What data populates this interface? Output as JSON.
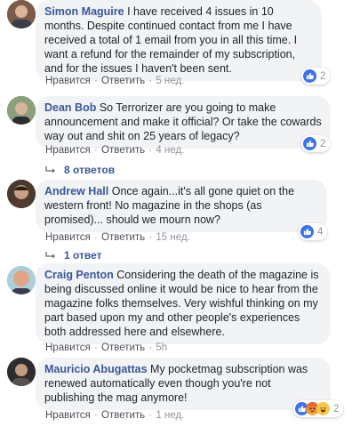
{
  "comments": [
    {
      "author": "Simon Maguire",
      "text": "I have received 4 issues in 10 months. Despite continued contact from me I have received a total of 1 email from you in all this time. I want a refund for the remainder of my subscription, and for the issues I haven't been sent.",
      "like_label": "Нравится",
      "reply_label": "Ответить",
      "time": "5 нед.",
      "reaction_count": "2",
      "avatar_color": "#8a6a57"
    },
    {
      "author": "Dean Bob",
      "text": "So Terrorizer are you going to make announcement and make it official? Or take the cowards way out and shit on 25 years of legacy?",
      "like_label": "Нравится",
      "reply_label": "Ответить",
      "time": "4 нед.",
      "reaction_count": "2",
      "replies_label": "8 ответов",
      "avatar_color": "#6b7a5a"
    },
    {
      "author": "Andrew Hall",
      "text": "Once again...it's all gone quiet on the western front! No magazine in the shops (as promised)... should we mourn now?",
      "like_label": "Нравится",
      "reply_label": "Ответить",
      "time": "15 нед.",
      "reaction_count": "4",
      "replies_label": "1 ответ",
      "avatar_color": "#5a4535"
    },
    {
      "author": "Craig Penton",
      "text": "Considering the death of the magazine is being discussed online it would be nice to hear from the magazine folks themselves. Very wishful thinking on my part based upon my and other people's experiences both addressed here and elsewhere.",
      "like_label": "Нравится",
      "reply_label": "Ответить",
      "time": "5h",
      "avatar_color": "#c88f6e"
    },
    {
      "author": "Mauricio Abugattas",
      "text": "My pocketmag subscription was renewed automatically even though you're not publishing the mag anymore!",
      "like_label": "Нравится",
      "reply_label": "Ответить",
      "time": "1 нед.",
      "reaction_count": "2",
      "avatar_color": "#3d3a3a"
    }
  ],
  "colors": {
    "link": "#385898",
    "bubble": "#f2f3f5",
    "meta": "#90949c",
    "like_reaction": "#3b74e8"
  },
  "icons": [
    "like-reaction-icon",
    "haha-reaction-icon",
    "angry-reaction-icon",
    "reply-arrow-icon"
  ]
}
